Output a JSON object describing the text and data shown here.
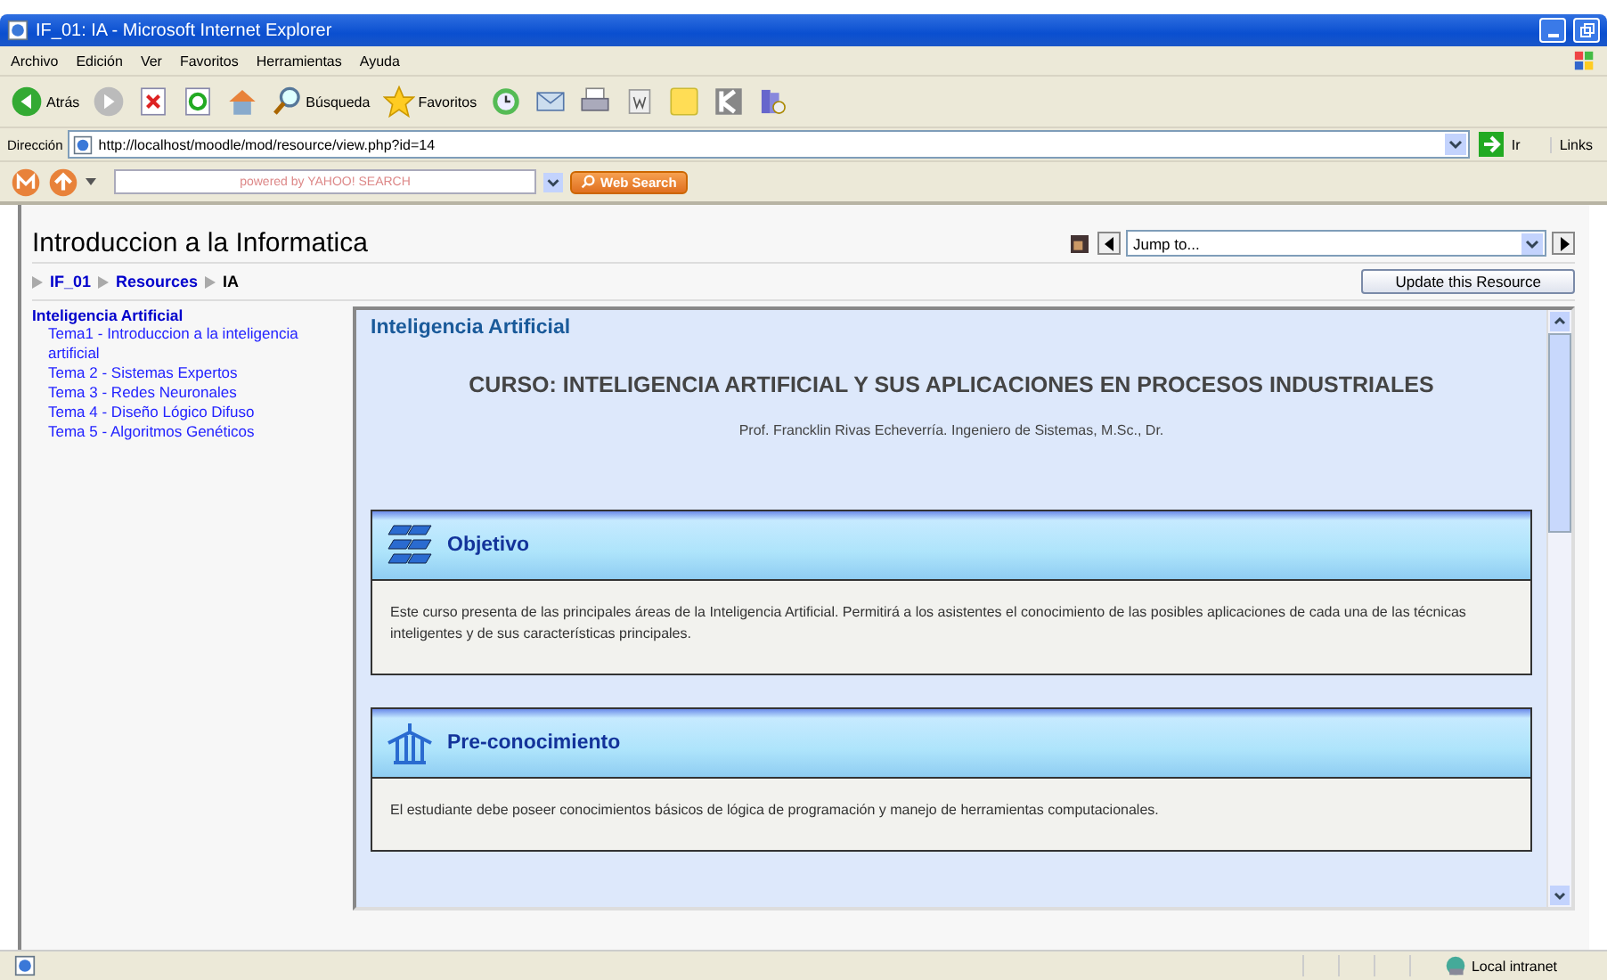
{
  "window": {
    "title": "IF_01: IA - Microsoft Internet Explorer"
  },
  "menu": [
    "Archivo",
    "Edición",
    "Ver",
    "Favoritos",
    "Herramientas",
    "Ayuda"
  ],
  "toolbar": [
    {
      "kind": "back",
      "label": "Atrás"
    },
    {
      "kind": "forward"
    },
    {
      "kind": "stop"
    },
    {
      "kind": "refresh"
    },
    {
      "kind": "home"
    },
    {
      "kind": "search",
      "label": "Búsqueda"
    },
    {
      "kind": "favorites",
      "label": "Favoritos"
    },
    {
      "kind": "history"
    },
    {
      "kind": "mail"
    },
    {
      "kind": "print"
    },
    {
      "kind": "word"
    },
    {
      "kind": "note"
    },
    {
      "kind": "k"
    },
    {
      "kind": "book"
    }
  ],
  "address": {
    "label": "Dirección",
    "value": "http://localhost/moodle/mod/resource/view.php?id=14",
    "go": "Ir",
    "links": "Links"
  },
  "yahoo": {
    "placeholder": "powered by YAHOO! SEARCH",
    "button": "Web Search"
  },
  "page": {
    "title": "Introduccion a la Informatica",
    "jump": "Jump to...",
    "breadcrumb": [
      "IF_01",
      "Resources",
      "IA"
    ],
    "update": "Update this Resource"
  },
  "sidebar": {
    "heading": "Inteligencia Artificial",
    "items": [
      "Tema1 - Introduccion a la inteligencia artificial",
      "Tema 2 - Sistemas Expertos",
      "Tema 3 - Redes Neuronales",
      "Tema 4 - Diseño Lógico Difuso",
      "Tema 5 - Algoritmos Genéticos"
    ]
  },
  "frame": {
    "heading": "Inteligencia Artificial",
    "course": "CURSO: INTELIGENCIA ARTIFICIAL Y SUS APLICACIONES EN PROCESOS INDUSTRIALES",
    "author": "Prof. Francklin Rivas Echeverría. Ingeniero de Sistemas, M.Sc., Dr.",
    "sections": [
      {
        "kind": "objective",
        "title": "Objetivo",
        "text": "Este curso presenta de las principales áreas de la Inteligencia Artificial. Permitirá a los asistentes el conocimiento de las posibles aplicaciones de cada una de las técnicas inteligentes y de sus características principales."
      },
      {
        "kind": "prior",
        "title": "Pre-conocimiento",
        "text": "El estudiante debe poseer conocimientos básicos de lógica de programación y manejo de herramientas computacionales."
      }
    ]
  },
  "status": {
    "zone": "Local intranet"
  }
}
